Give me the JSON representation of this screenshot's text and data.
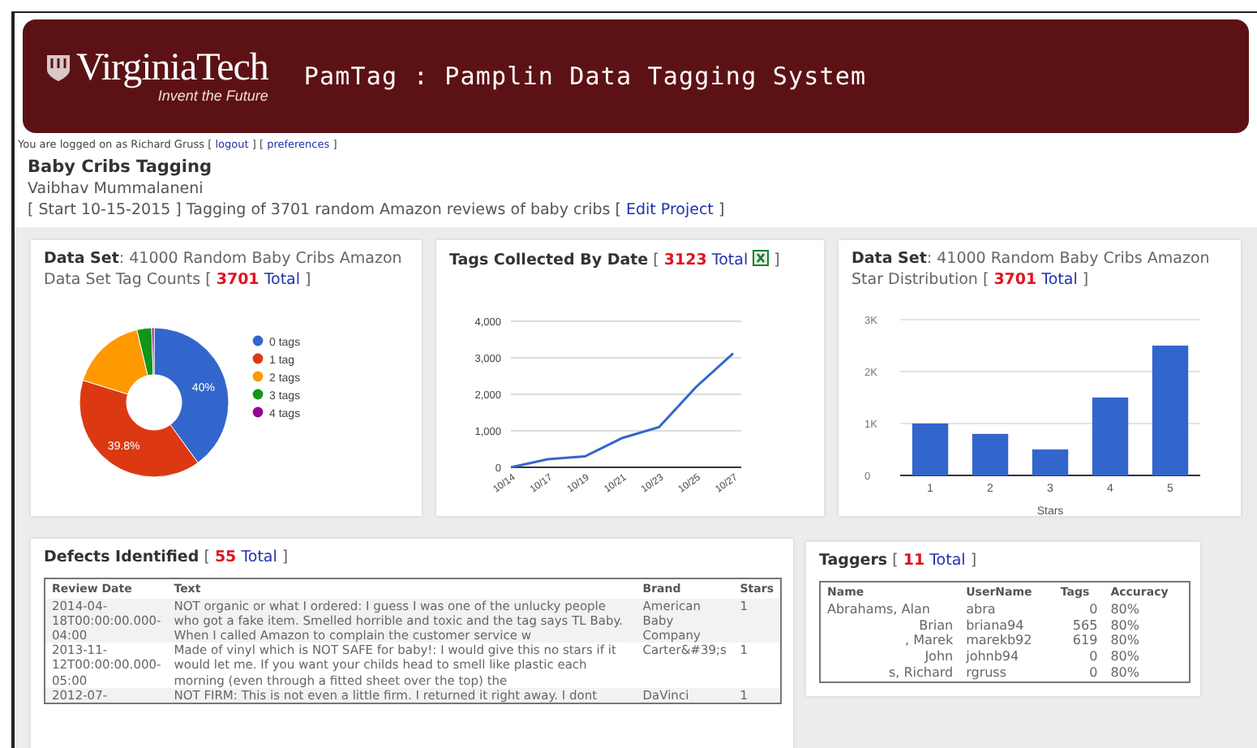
{
  "header": {
    "logo": "VirginiaTech",
    "tagline": "Invent the Future",
    "title": "PamTag : Pamplin Data Tagging System"
  },
  "login": {
    "text": "You are logged on as Richard Gruss [",
    "logout": "logout",
    "mid": "] [",
    "preferences": "preferences",
    "end": "]"
  },
  "project": {
    "title": "Baby Cribs Tagging",
    "owner": "Vaibhav Mummalaneni",
    "summary": "[ Start 10-15-2015 ] Tagging of 3701 random Amazon reviews of baby cribs [",
    "edit": "Edit Project",
    "summary_end": "]"
  },
  "panels": [
    {
      "heading": "**Data Set**: 41000 Random Baby Cribs Amazon Data Set Tag Counts [",
      "count": "3701",
      "link": "Total",
      "heading_end": "]",
      "chart_data": {
        "type": "donut",
        "categories": [
          "0 tags",
          "1 tag",
          "2 tags",
          "3 tags",
          "4 tags"
        ],
        "colors": [
          "#3366cc",
          "#dc3912",
          "#ff9900",
          "#109618",
          "#990099"
        ],
        "values": [
          40,
          39.8,
          16.5,
          3.2,
          0.5
        ],
        "value_labels": [
          "40%",
          "39.8%",
          null,
          null,
          null
        ],
        "legend": "right"
      }
    },
    {
      "heading": "**Tags Collected By Date** [",
      "count": "3123",
      "link": "Total",
      "export": true,
      "heading_end": "]",
      "chart_data": {
        "type": "line",
        "categories": [
          "10/14",
          "10/17",
          "10/19",
          "10/21",
          "10/23",
          "10/25",
          "10/27"
        ],
        "series": [
          {
            "color": "#3366cc",
            "values": [
              0,
              220,
              300,
              800,
              1100,
              2200,
              3120
            ]
          }
        ],
        "ylim": [
          0,
          4000
        ],
        "grid": true,
        "yticks": [
          {
            "value": 0,
            "label": "0"
          },
          {
            "value": 1000,
            "label": "1,000"
          },
          {
            "value": 2000,
            "label": "2,000"
          },
          {
            "value": 3000,
            "label": "3,000"
          },
          {
            "value": 4000,
            "label": "4,000"
          }
        ]
      }
    },
    {
      "heading": "**Data Set**: 41000 Random Baby Cribs Amazon Star Distribution [",
      "count": "3701",
      "link": "Total",
      "heading_end": "]",
      "chart_data": {
        "type": "bar",
        "categories": [
          "1",
          "2",
          "3",
          "4",
          "5"
        ],
        "series": [
          {
            "color": "#3366cc",
            "values": [
              1000,
              800,
              500,
              1500,
              2500
            ]
          }
        ],
        "xlabel": "Stars",
        "grid": true,
        "ylim": [
          0,
          3000
        ],
        "yticks": [
          {
            "value": 0,
            "label": "0"
          },
          {
            "value": 1000,
            "label": "1K"
          },
          {
            "value": 2000,
            "label": "2K"
          },
          {
            "value": 3000,
            "label": "3K"
          }
        ]
      }
    }
  ],
  "defects": {
    "heading": "**Defects Identified** [",
    "count": "55",
    "link": "Total",
    "heading_end": "]",
    "columns": [
      "Review Date",
      "Text",
      "Brand",
      "Stars"
    ],
    "rows": [
      [
        "2014-04-18T00:00:00.000-04:00",
        "NOT organic or what I ordered: I guess I was one of the unlucky people who got a fake item. Smelled horrible and toxic and the tag says TL Baby. When I called Amazon to complain the customer service w",
        "American Baby Company",
        "1"
      ],
      [
        "2013-11-12T00:00:00.000-05:00",
        "Made of vinyl which is NOT SAFE for baby!: I would give this no stars if it would let me. If you want your childs head to smell like plastic each morning (even through a fitted sheet over the top) the",
        "Carter&#39;s",
        "1"
      ],
      [
        "2012-07-",
        "NOT FIRM: This is not even a little firm. I returned it right away. I dont",
        "DaVinci",
        "1"
      ]
    ]
  },
  "taggers": {
    "heading": "**Taggers** [",
    "count": "11",
    "link": "Total",
    "heading_end": "]",
    "columns": [
      "Name",
      "UserName",
      "Tags",
      "Accuracy"
    ],
    "rows": [
      [
        "Abrahams, Alan",
        "abra",
        "0",
        "80%"
      ],
      [
        "Brian",
        "briana94",
        "565",
        "80%"
      ],
      [
        ", Marek",
        "marekb92",
        "619",
        "80%"
      ],
      [
        "John",
        "johnb94",
        "0",
        "80%"
      ],
      [
        "s, Richard",
        "rgruss",
        "0",
        "80%"
      ]
    ]
  }
}
